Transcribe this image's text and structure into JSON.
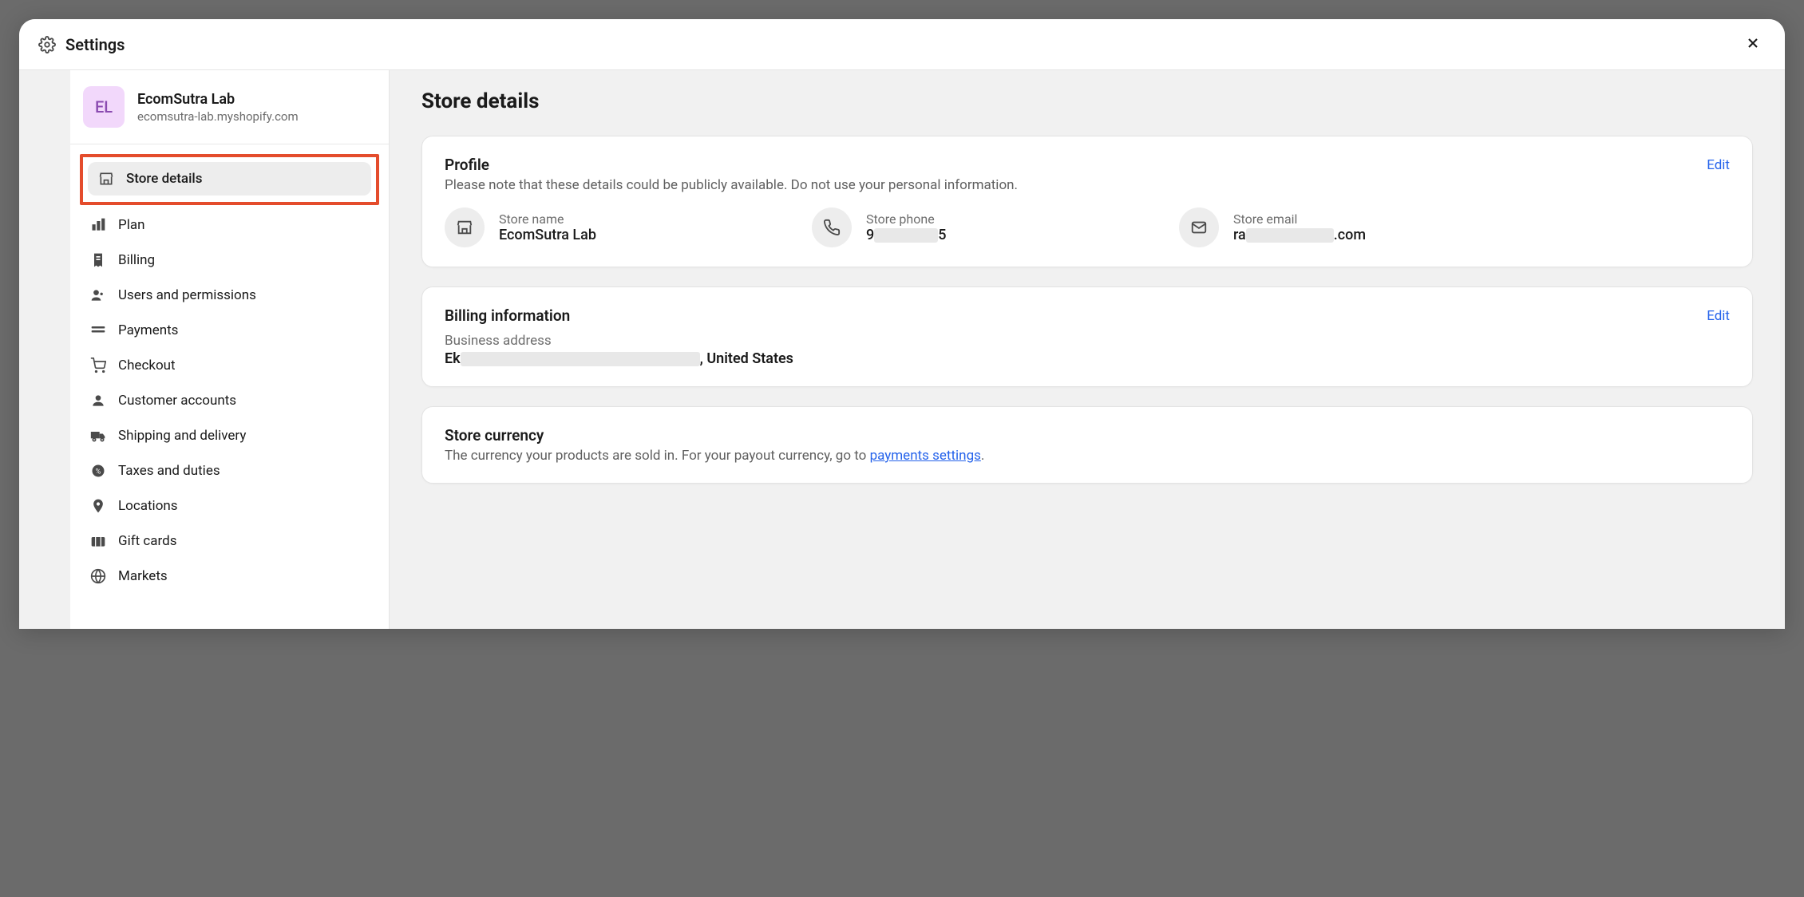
{
  "header": {
    "title": "Settings"
  },
  "store": {
    "avatar_initials": "EL",
    "name": "EcomSutra Lab",
    "url": "ecomsutra-lab.myshopify.com"
  },
  "sidebar": {
    "items": [
      {
        "label": "Store details"
      },
      {
        "label": "Plan"
      },
      {
        "label": "Billing"
      },
      {
        "label": "Users and permissions"
      },
      {
        "label": "Payments"
      },
      {
        "label": "Checkout"
      },
      {
        "label": "Customer accounts"
      },
      {
        "label": "Shipping and delivery"
      },
      {
        "label": "Taxes and duties"
      },
      {
        "label": "Locations"
      },
      {
        "label": "Gift cards"
      },
      {
        "label": "Markets"
      }
    ]
  },
  "main": {
    "page_title": "Store details",
    "profile": {
      "title": "Profile",
      "subtitle": "Please note that these details could be publicly available. Do not use your personal information.",
      "edit_label": "Edit",
      "store_name_label": "Store name",
      "store_name_value": "EcomSutra Lab",
      "store_phone_label": "Store phone",
      "store_phone_prefix": "9",
      "store_phone_suffix": "5",
      "store_email_label": "Store email",
      "store_email_prefix": "ra",
      "store_email_suffix": ".com"
    },
    "billing": {
      "title": "Billing information",
      "edit_label": "Edit",
      "business_address_label": "Business address",
      "business_address_prefix": "Ek",
      "business_address_suffix": ", United States"
    },
    "currency": {
      "title": "Store currency",
      "desc_before": "The currency your products are sold in. For your payout currency, go to ",
      "link_label": "payments settings",
      "desc_after": "."
    }
  }
}
